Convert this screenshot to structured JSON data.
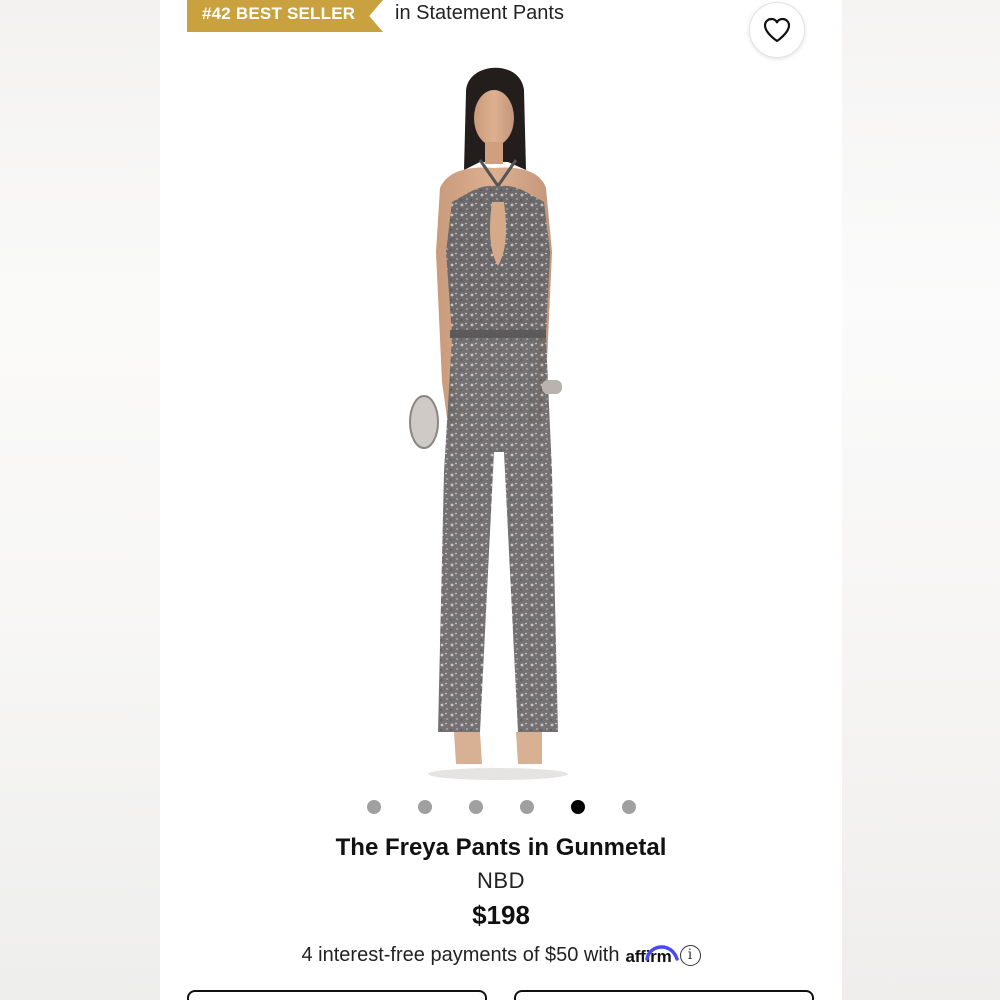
{
  "badge": {
    "label": "#42 BEST SELLER",
    "color": "#c9a23f"
  },
  "category": {
    "text": "in Statement Pants"
  },
  "wishlist": {
    "icon": "heart-icon"
  },
  "gallery": {
    "image_count": 6,
    "active_index": 4
  },
  "product": {
    "title": "The Freya Pants in Gunmetal",
    "brand": "NBD",
    "price": "$198"
  },
  "financing": {
    "text": "4 interest-free payments of $50 with",
    "provider": "affirm",
    "info_icon": "info-icon",
    "provider_color": "#4a4af4"
  }
}
